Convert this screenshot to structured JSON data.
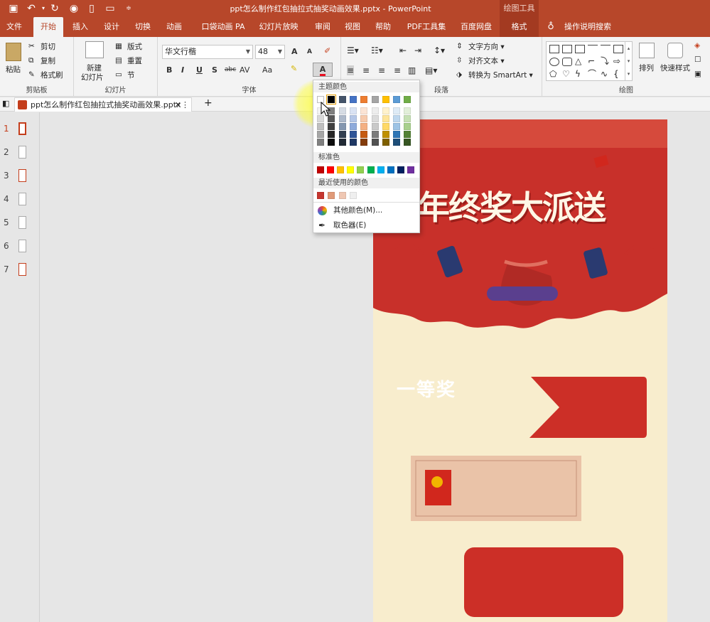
{
  "window": {
    "title": "ppt怎么制作红包抽拉式抽奖动画效果.pptx  -  PowerPoint",
    "context_tab_group": "绘图工具"
  },
  "tabs": [
    {
      "label": "文件"
    },
    {
      "label": "开始"
    },
    {
      "label": "插入"
    },
    {
      "label": "设计"
    },
    {
      "label": "切换"
    },
    {
      "label": "动画"
    },
    {
      "label": "口袋动画 PA"
    },
    {
      "label": "幻灯片放映"
    },
    {
      "label": "审阅"
    },
    {
      "label": "视图"
    },
    {
      "label": "帮助"
    },
    {
      "label": "PDF工具集"
    },
    {
      "label": "百度网盘"
    },
    {
      "label": "格式"
    }
  ],
  "tell_me": "操作说明搜索",
  "ribbon": {
    "clipboard": {
      "paste": "粘贴",
      "cut": "剪切",
      "copy": "复制",
      "format_painter": "格式刷",
      "group": "剪贴板"
    },
    "slides": {
      "new_slide": "新建",
      "new_slide2": "幻灯片",
      "layout": "版式",
      "reset": "重置",
      "section": "节",
      "group": "幻灯片"
    },
    "font": {
      "name": "华文行楷",
      "size": "48",
      "group": "字体",
      "bold": "B",
      "italic": "I",
      "underline": "U",
      "shadow": "S",
      "strike": "abc",
      "spacing": "AV",
      "case": "Aa",
      "grow": "A",
      "shrink": "A",
      "font_color": "A"
    },
    "paragraph": {
      "text_direction": "文字方向",
      "align_text": "对齐文本",
      "smartart": "转换为 SmartArt",
      "group": "段落"
    },
    "drawing": {
      "arrange": "排列",
      "quick_styles": "快速样式",
      "group": "绘图"
    }
  },
  "document_tab": {
    "label": "ppt怎么制作红包抽拉式抽奖动画效果.pptx"
  },
  "slide_numbers": [
    "1",
    "2",
    "3",
    "4",
    "5",
    "6",
    "7"
  ],
  "slide": {
    "banner_text": "年终奖大派送",
    "prize_label": "一等奖"
  },
  "color_panel": {
    "theme_title": "主题颜色",
    "standard_title": "标准色",
    "recent_title": "最近使用的颜色",
    "more_colors": "其他颜色(M)...",
    "eyedropper": "取色器(E)",
    "theme_top": [
      "#ffffff",
      "#000000",
      "#44546a",
      "#4472c4",
      "#ed7d31",
      "#a5a5a5",
      "#ffc000",
      "#5b9bd5",
      "#70ad47"
    ],
    "theme_cols": [
      [
        "#f2f2f2",
        "#d9d9d9",
        "#bfbfbf",
        "#a6a6a6",
        "#808080"
      ],
      [
        "#7f7f7f",
        "#595959",
        "#404040",
        "#262626",
        "#0d0d0d"
      ],
      [
        "#d6dce4",
        "#adb9ca",
        "#8497b0",
        "#333f50",
        "#222a35"
      ],
      [
        "#d9e2f3",
        "#b4c6e7",
        "#8eaadb",
        "#2f5496",
        "#1f3864"
      ],
      [
        "#fbe4d5",
        "#f7caac",
        "#f4b083",
        "#c55a11",
        "#833c0b"
      ],
      [
        "#ededed",
        "#dbdbdb",
        "#c9c9c9",
        "#7b7b7b",
        "#525252"
      ],
      [
        "#fff2cc",
        "#fee599",
        "#ffd966",
        "#bf9000",
        "#7f6000"
      ],
      [
        "#deebf6",
        "#bdd7ee",
        "#9cc3e5",
        "#2e75b5",
        "#1e4e79"
      ],
      [
        "#e2efd9",
        "#c5e0b3",
        "#a8d08d",
        "#538135",
        "#375623"
      ]
    ],
    "standard": [
      "#c00000",
      "#ff0000",
      "#ffc000",
      "#ffff00",
      "#92d050",
      "#00b050",
      "#00b0f0",
      "#0070c0",
      "#002060",
      "#7030a0"
    ],
    "recent": [
      "#c5362f",
      "#e09a78",
      "#efc7b3",
      "#efefef"
    ]
  }
}
